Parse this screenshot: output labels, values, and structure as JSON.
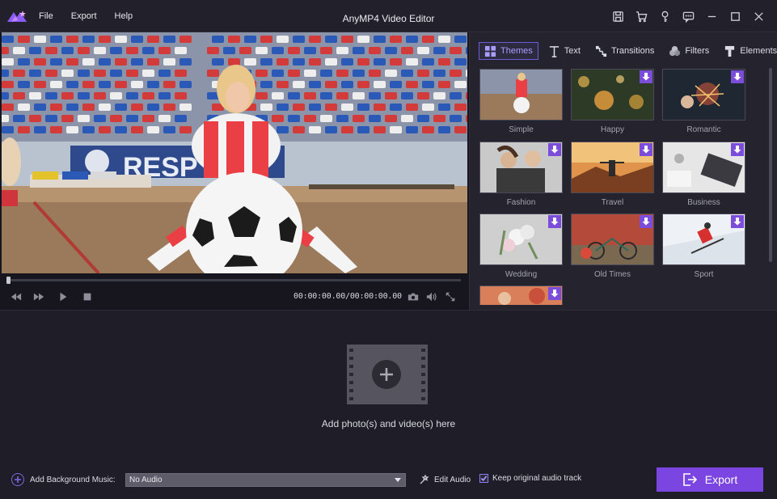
{
  "app": {
    "title": "AnyMP4 Video Editor"
  },
  "menu": [
    {
      "label": "File"
    },
    {
      "label": "Export"
    },
    {
      "label": "Help"
    }
  ],
  "window_controls": [
    "save-icon",
    "cart-icon",
    "key-icon",
    "feedback-icon",
    "minimize-icon",
    "maximize-icon",
    "close-icon"
  ],
  "player": {
    "timecode": "00:00:00.00/00:00:00.00",
    "progress": 0
  },
  "tabs": [
    {
      "label": "Themes",
      "icon": "themes-icon",
      "active": true
    },
    {
      "label": "Text",
      "icon": "text-icon"
    },
    {
      "label": "Transitions",
      "icon": "transitions-icon"
    },
    {
      "label": "Filters",
      "icon": "filters-icon"
    },
    {
      "label": "Elements",
      "icon": "elements-icon"
    }
  ],
  "themes": [
    {
      "label": "Simple",
      "download": false
    },
    {
      "label": "Happy",
      "download": true
    },
    {
      "label": "Romantic",
      "download": true
    },
    {
      "label": "Fashion",
      "download": true
    },
    {
      "label": "Travel",
      "download": true
    },
    {
      "label": "Business",
      "download": true
    },
    {
      "label": "Wedding",
      "download": true
    },
    {
      "label": "Old Times",
      "download": true
    },
    {
      "label": "Sport",
      "download": true
    },
    {
      "label": "",
      "download": true
    }
  ],
  "drop": {
    "label": "Add photo(s) and video(s) here"
  },
  "bottom": {
    "bg_music_label": "Add Background Music:",
    "audio_value": "No Audio",
    "edit_audio": "Edit Audio",
    "keep_audio": "Keep original audio track",
    "keep_audio_checked": true,
    "export": "Export"
  },
  "colors": {
    "accent": "#7a45e0",
    "tab_active": "#a99cff"
  }
}
